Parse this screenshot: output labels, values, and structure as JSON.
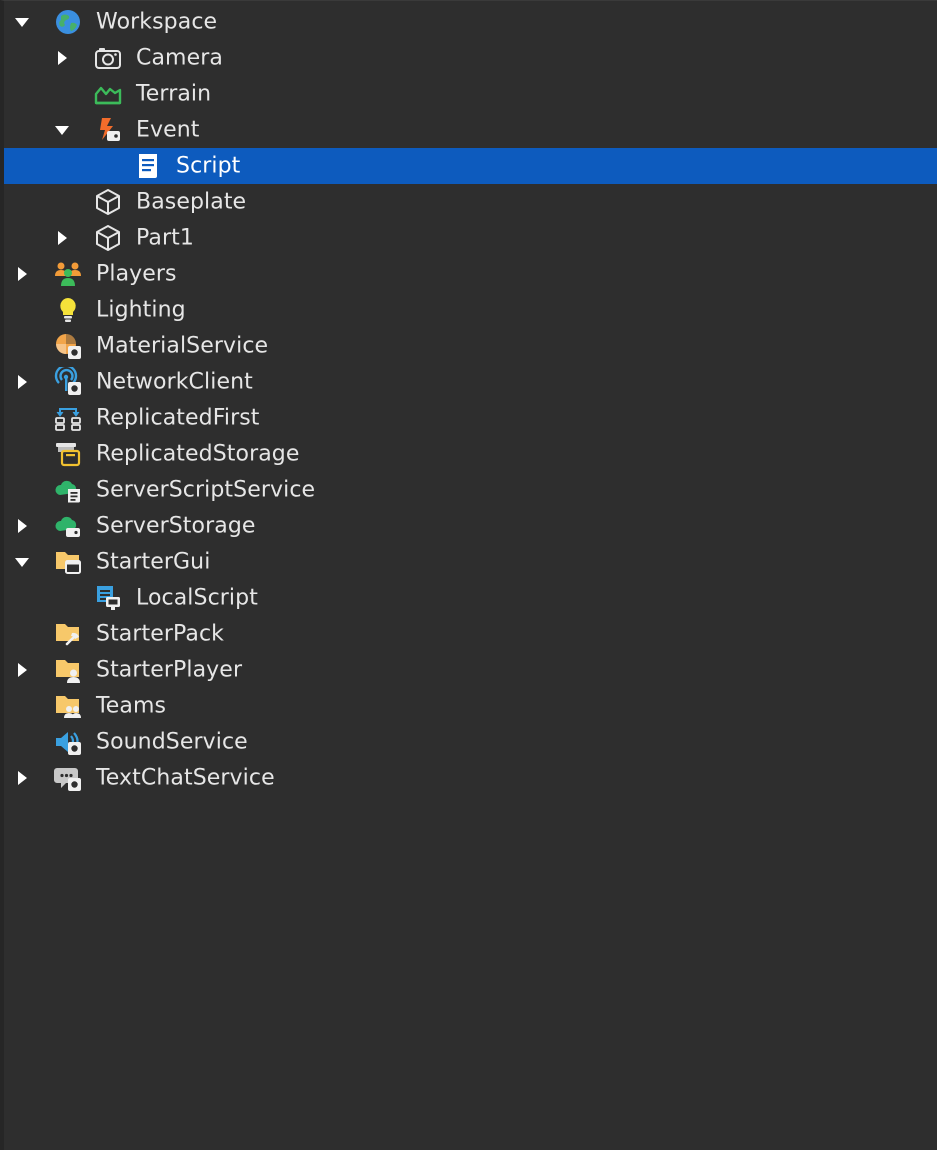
{
  "explorer": {
    "selected_color": "#0d5bbe",
    "items": [
      {
        "label": "Workspace",
        "icon": "globe-icon",
        "depth": 0,
        "toggle": "expanded",
        "selected": false
      },
      {
        "label": "Camera",
        "icon": "camera-icon",
        "depth": 1,
        "toggle": "collapsed",
        "selected": false
      },
      {
        "label": "Terrain",
        "icon": "terrain-icon",
        "depth": 1,
        "toggle": "none",
        "selected": false
      },
      {
        "label": "Event",
        "icon": "event-icon",
        "depth": 1,
        "toggle": "expanded",
        "selected": false
      },
      {
        "label": "Script",
        "icon": "script-icon",
        "depth": 2,
        "toggle": "none",
        "selected": true
      },
      {
        "label": "Baseplate",
        "icon": "part-icon",
        "depth": 1,
        "toggle": "none",
        "selected": false
      },
      {
        "label": "Part1",
        "icon": "part-icon",
        "depth": 1,
        "toggle": "collapsed",
        "selected": false
      },
      {
        "label": "Players",
        "icon": "players-icon",
        "depth": 0,
        "toggle": "collapsed",
        "selected": false
      },
      {
        "label": "Lighting",
        "icon": "lightbulb-icon",
        "depth": 0,
        "toggle": "none",
        "selected": false
      },
      {
        "label": "MaterialService",
        "icon": "material-service-icon",
        "depth": 0,
        "toggle": "none",
        "selected": false
      },
      {
        "label": "NetworkClient",
        "icon": "network-client-icon",
        "depth": 0,
        "toggle": "collapsed",
        "selected": false
      },
      {
        "label": "ReplicatedFirst",
        "icon": "replicated-first-icon",
        "depth": 0,
        "toggle": "none",
        "selected": false
      },
      {
        "label": "ReplicatedStorage",
        "icon": "replicated-storage-icon",
        "depth": 0,
        "toggle": "none",
        "selected": false
      },
      {
        "label": "ServerScriptService",
        "icon": "server-script-service-icon",
        "depth": 0,
        "toggle": "none",
        "selected": false
      },
      {
        "label": "ServerStorage",
        "icon": "server-storage-icon",
        "depth": 0,
        "toggle": "collapsed",
        "selected": false
      },
      {
        "label": "StarterGui",
        "icon": "starter-gui-icon",
        "depth": 0,
        "toggle": "expanded",
        "selected": false
      },
      {
        "label": "LocalScript",
        "icon": "local-script-icon",
        "depth": 1,
        "toggle": "none",
        "selected": false
      },
      {
        "label": "StarterPack",
        "icon": "starter-pack-icon",
        "depth": 0,
        "toggle": "none",
        "selected": false
      },
      {
        "label": "StarterPlayer",
        "icon": "starter-player-icon",
        "depth": 0,
        "toggle": "collapsed",
        "selected": false
      },
      {
        "label": "Teams",
        "icon": "teams-icon",
        "depth": 0,
        "toggle": "none",
        "selected": false
      },
      {
        "label": "SoundService",
        "icon": "sound-service-icon",
        "depth": 0,
        "toggle": "none",
        "selected": false
      },
      {
        "label": "TextChatService",
        "icon": "text-chat-service-icon",
        "depth": 0,
        "toggle": "collapsed",
        "selected": false
      }
    ]
  }
}
